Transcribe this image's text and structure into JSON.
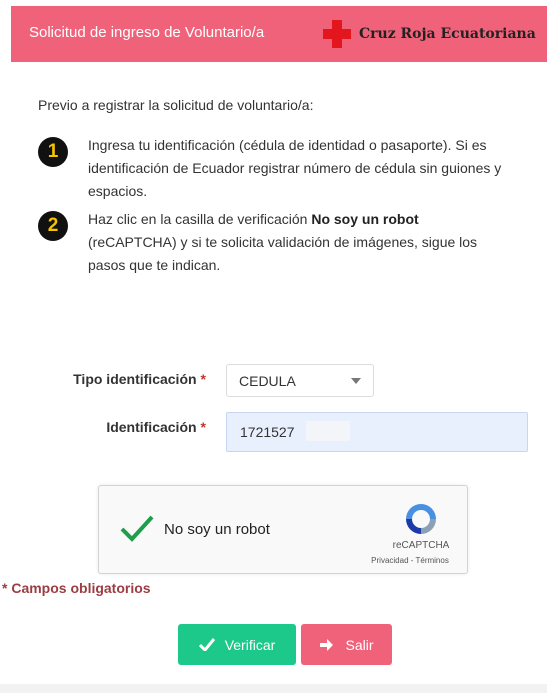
{
  "header": {
    "title": "Solicitud de ingreso de Voluntario/a",
    "brand_name": "Cruz Roja Ecuatoriana",
    "background_color": "#f0627a",
    "logo_icon": "red-cross-icon"
  },
  "instructions": {
    "intro": "Previo a registrar la solicitud de voluntario/a:",
    "steps": [
      {
        "number": "1",
        "text": "Ingresa tu identificación (cédula de identidad o pasaporte). Si es identificación de Ecuador registrar número de cédula sin guiones y espacios."
      },
      {
        "number": "2",
        "text_before": "Haz clic en la casilla de verificación ",
        "text_bold": "No soy un robot",
        "text_after": " (reCAPTCHA) y si te solicita validación de imágenes, sigue los pasos que te indican."
      }
    ]
  },
  "form": {
    "id_type_label": "Tipo identificación",
    "id_type_value": "CEDULA",
    "id_label": "Identificación",
    "id_value": "1721527",
    "required_marker": "*"
  },
  "captcha": {
    "label": "No soy un robot",
    "brand": "reCAPTCHA",
    "links": "Privacidad - Términos",
    "checked": true,
    "check_color": "#1e9e4a"
  },
  "required_note": "* Campos obligatorios",
  "buttons": {
    "verify_label": "Verificar",
    "verify_color": "#1cc88a",
    "exit_label": "Salir",
    "exit_color": "#f0627a"
  }
}
